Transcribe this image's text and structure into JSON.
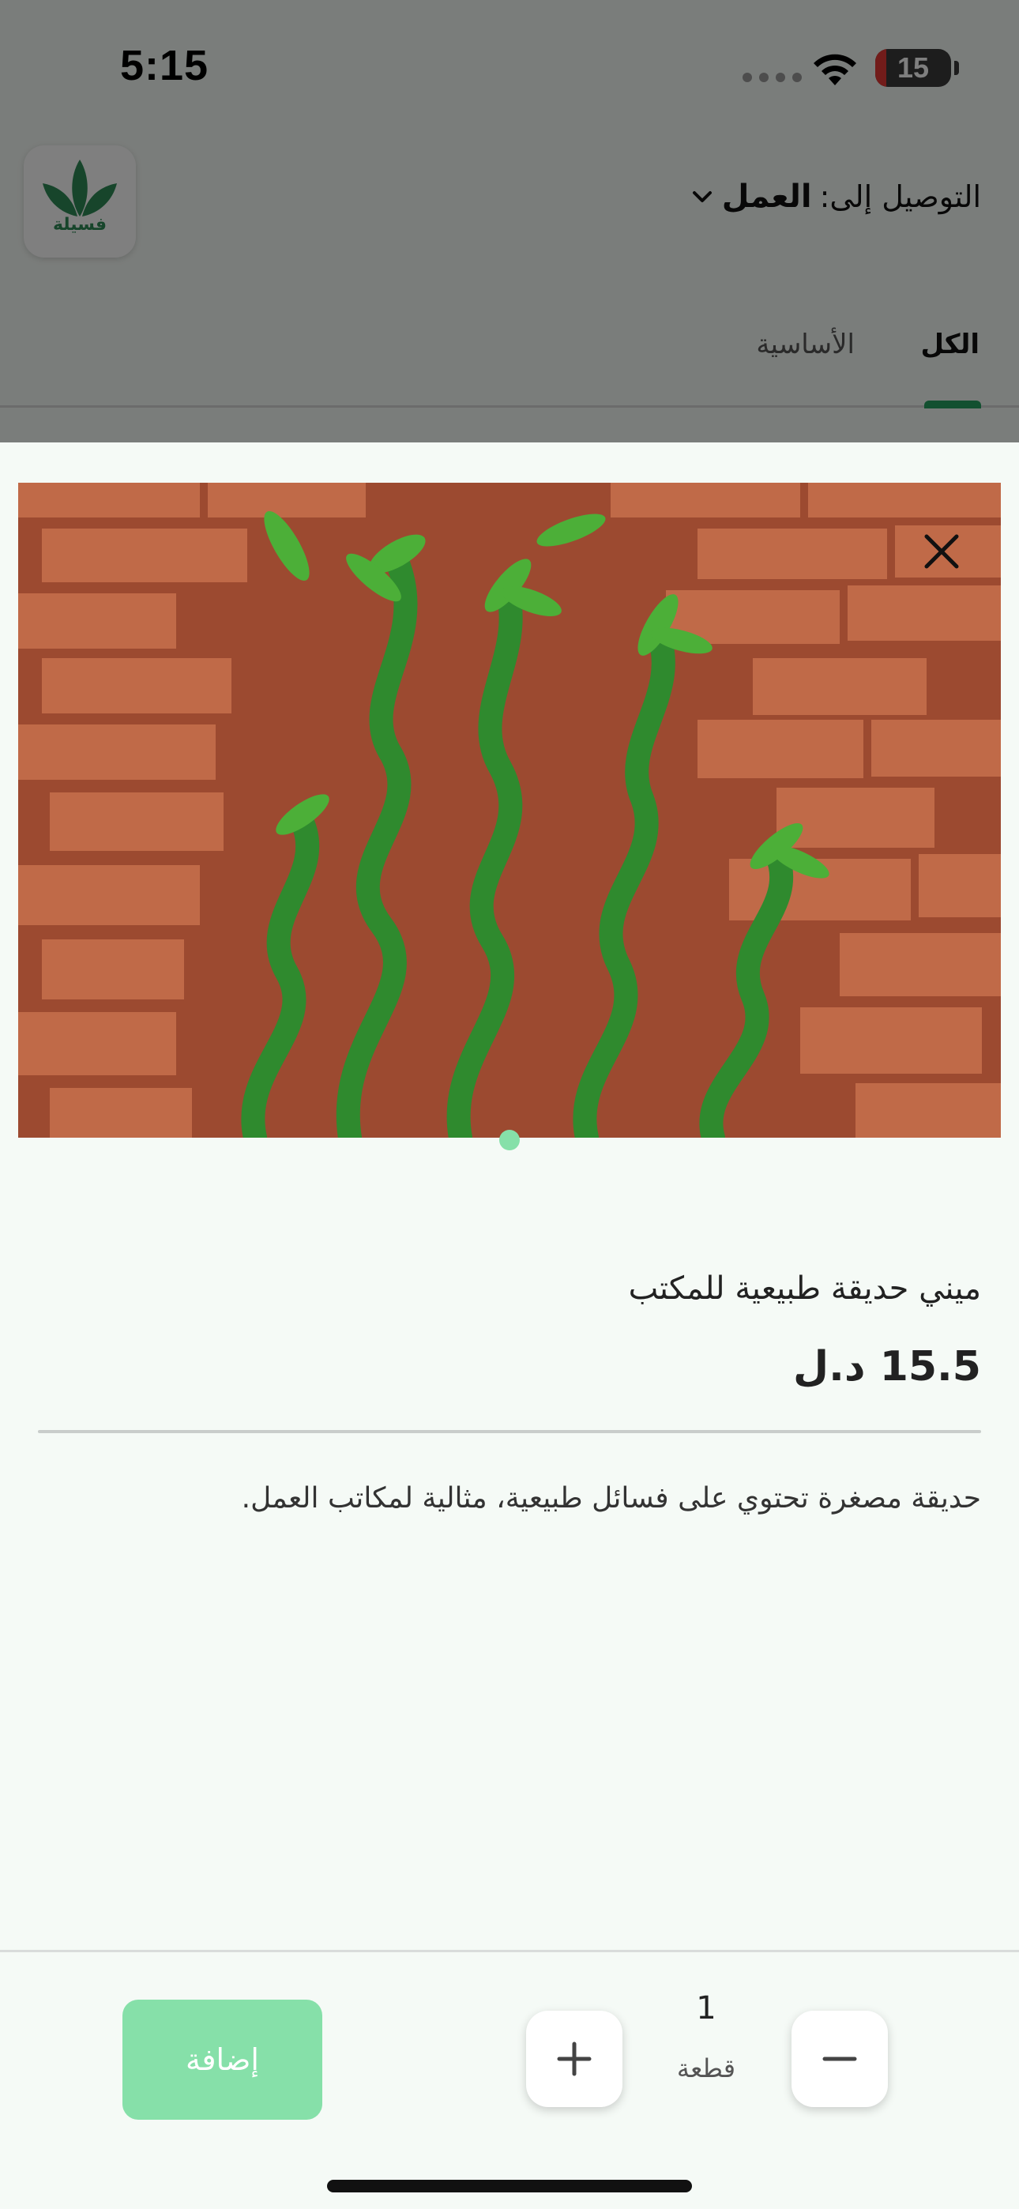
{
  "status_bar": {
    "time": "5:15",
    "battery_level": "15"
  },
  "header": {
    "logo_text": "فسيلة",
    "deliver_label": "التوصيل إلى:",
    "deliver_value": "العمل",
    "chevron_icon": "chevron-down-icon"
  },
  "tabs": [
    {
      "label": "الكل",
      "active": true
    },
    {
      "label": "الأساسية",
      "active": false
    }
  ],
  "product": {
    "name": "ميني حديقة طبيعية للمكتب",
    "price": "15.5 د.ل",
    "description": "حديقة مصغرة تحتوي على فسائل طبيعية، مثالية لمكاتب العمل.",
    "image_icon": "lucky-bamboo-photo",
    "close_icon": "close-icon"
  },
  "footer": {
    "add_label": "إضافة",
    "quantity": "1",
    "unit": "قطعة",
    "plus_icon": "plus-icon",
    "minus_icon": "minus-icon"
  },
  "colors": {
    "accent": "#27a160",
    "button_light": "#86e0a9",
    "sheet_background": "#f5faf6"
  }
}
